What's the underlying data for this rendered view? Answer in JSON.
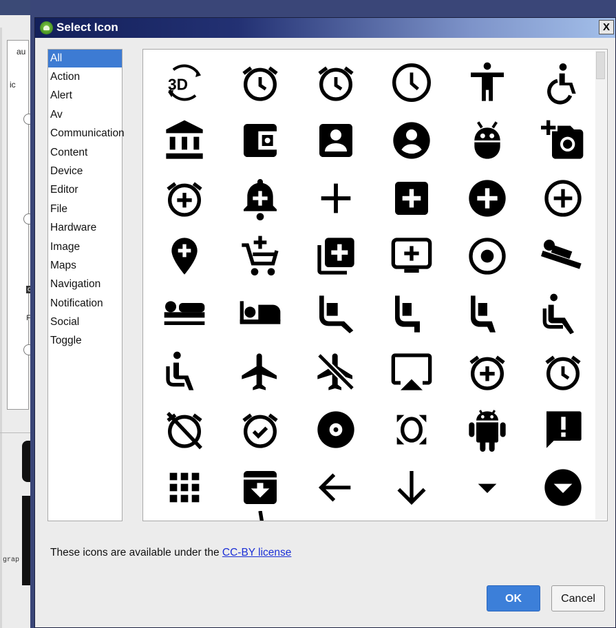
{
  "dialog": {
    "title": "Select Icon",
    "close_label": "X"
  },
  "categories": {
    "selected": "All",
    "items": [
      "All",
      "Action",
      "Alert",
      "Av",
      "Communication",
      "Content",
      "Device",
      "Editor",
      "File",
      "Hardware",
      "Image",
      "Maps",
      "Navigation",
      "Notification",
      "Social",
      "Toggle"
    ]
  },
  "icons": [
    "3d-rotation-icon",
    "access-alarm-icon",
    "access-alarms-icon",
    "access-time-icon",
    "accessibility-icon",
    "accessible-icon",
    "account-balance-icon",
    "account-balance-wallet-icon",
    "account-box-icon",
    "account-circle-icon",
    "adb-icon",
    "add-a-photo-icon",
    "add-alarm-icon",
    "add-alert-icon",
    "add-icon",
    "add-box-icon",
    "add-circle-icon",
    "add-circle-outline-icon",
    "add-location-icon",
    "add-shopping-cart-icon",
    "add-to-photos-icon",
    "add-to-queue-icon",
    "adjust-icon",
    "airline-seat-flat-angled-icon",
    "airline-seat-flat-icon",
    "airline-seat-individual-suite-icon",
    "airline-seat-legroom-extra-icon",
    "airline-seat-legroom-normal-icon",
    "airline-seat-legroom-reduced-icon",
    "airline-seat-recline-extra-icon",
    "airline-seat-recline-normal-icon",
    "airplanemode-active-icon",
    "airplanemode-inactive-icon",
    "airplay-icon",
    "alarm-add-icon",
    "alarm-icon",
    "alarm-off-icon",
    "alarm-on-icon",
    "album-icon",
    "all-out-icon",
    "android-icon",
    "announcement-icon",
    "apps-icon",
    "archive-icon",
    "arrow-back-icon",
    "arrow-downward-icon",
    "arrow-drop-down-icon",
    "arrow-drop-down-circle-icon"
  ],
  "footer": {
    "license_prefix": "These icons are available under the ",
    "license_link": "CC-BY license",
    "ok_label": "OK",
    "cancel_label": "Cancel"
  },
  "background_window": {
    "fragments": [
      "au",
      "ic",
      "o",
      "F",
      "grap"
    ]
  }
}
